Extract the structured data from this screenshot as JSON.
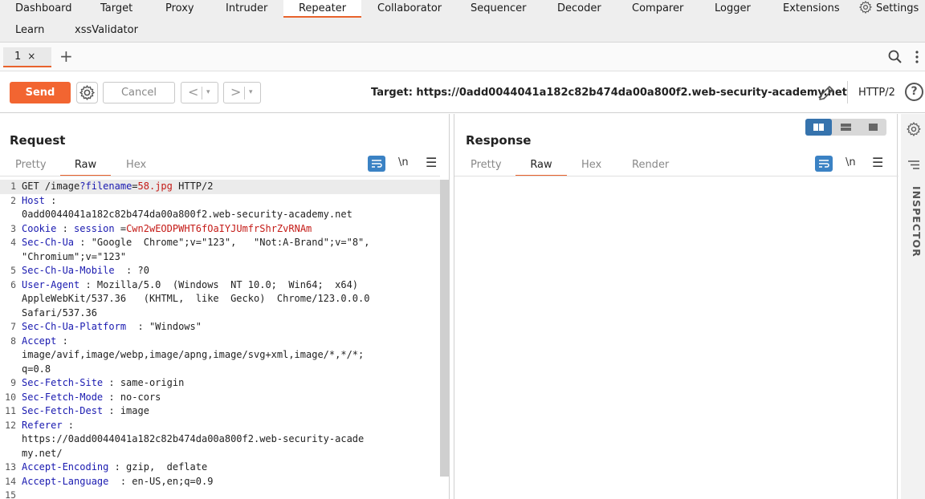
{
  "nav": {
    "items": [
      "Dashboard",
      "Target",
      "Proxy",
      "Intruder",
      "Repeater",
      "Collaborator",
      "Sequencer",
      "Decoder",
      "Comparer",
      "Logger",
      "Extensions"
    ],
    "settings": "Settings",
    "row2": [
      "Learn",
      "xssValidator"
    ],
    "active": "Repeater"
  },
  "tabs": {
    "items": [
      {
        "label": "1",
        "close": "×"
      }
    ],
    "add": "+"
  },
  "toolbar": {
    "send": "Send",
    "cancel": "Cancel",
    "back": "<",
    "forward": ">",
    "dropdown": "▾",
    "target": "Target: https://0add0044041a182c82b474da00a800f2.web-security-academy.net",
    "protocol": "HTTP/2",
    "help": "?"
  },
  "request": {
    "title": "Request",
    "tabs": [
      "Pretty",
      "Raw",
      "Hex"
    ],
    "active_tab": "Raw",
    "newline_toggle": "\\n",
    "lines": [
      {
        "n": "1",
        "parts": [
          [
            "",
            "GET "
          ],
          [
            "",
            "/image"
          ],
          [
            "k",
            "?filename"
          ],
          [
            "",
            "="
          ],
          [
            "v",
            "58.jpg"
          ],
          [
            "",
            " HTTP/2"
          ]
        ]
      },
      {
        "n": "2",
        "parts": [
          [
            "k",
            "Host"
          ],
          [
            "",
            " :"
          ]
        ]
      },
      {
        "n": "",
        "parts": [
          [
            "",
            "0add0044041a182c82b474da00a800f2.web-security-academy.net"
          ]
        ]
      },
      {
        "n": "3",
        "parts": [
          [
            "k",
            "Cookie"
          ],
          [
            "",
            " : "
          ],
          [
            "k",
            "session"
          ],
          [
            "",
            " ="
          ],
          [
            "v",
            "Cwn2wEODPWHT6fOaIYJUmfrShrZvRNAm"
          ]
        ]
      },
      {
        "n": "4",
        "parts": [
          [
            "k",
            "Sec-Ch-Ua"
          ],
          [
            "",
            " : \"Google  Chrome\";v=\"123\",   \"Not:A-Brand\";v=\"8\","
          ]
        ]
      },
      {
        "n": "",
        "parts": [
          [
            "",
            "\"Chromium\";v=\"123\""
          ]
        ]
      },
      {
        "n": "5",
        "parts": [
          [
            "k",
            "Sec-Ch-Ua-Mobile"
          ],
          [
            "",
            "  : ?0"
          ]
        ]
      },
      {
        "n": "6",
        "parts": [
          [
            "k",
            "User-Agent"
          ],
          [
            "",
            " : Mozilla/5.0  (Windows  NT 10.0;  Win64;  x64)"
          ]
        ]
      },
      {
        "n": "",
        "parts": [
          [
            "",
            "AppleWebKit/537.36   (KHTML,  like  Gecko)  Chrome/123.0.0.0"
          ]
        ]
      },
      {
        "n": "",
        "parts": [
          [
            "",
            "Safari/537.36"
          ]
        ]
      },
      {
        "n": "7",
        "parts": [
          [
            "k",
            "Sec-Ch-Ua-Platform"
          ],
          [
            "",
            "  : \"Windows\""
          ]
        ]
      },
      {
        "n": "8",
        "parts": [
          [
            "k",
            "Accept"
          ],
          [
            "",
            " :"
          ]
        ]
      },
      {
        "n": "",
        "parts": [
          [
            "",
            "image/avif,image/webp,image/apng,image/svg+xml,image/*,*/*;"
          ]
        ]
      },
      {
        "n": "",
        "parts": [
          [
            "",
            "q=0.8"
          ]
        ]
      },
      {
        "n": "9",
        "parts": [
          [
            "k",
            "Sec-Fetch-Site"
          ],
          [
            "",
            " : same-origin"
          ]
        ]
      },
      {
        "n": "10",
        "parts": [
          [
            "k",
            "Sec-Fetch-Mode"
          ],
          [
            "",
            " : no-cors"
          ]
        ]
      },
      {
        "n": "11",
        "parts": [
          [
            "k",
            "Sec-Fetch-Dest"
          ],
          [
            "",
            " : image"
          ]
        ]
      },
      {
        "n": "12",
        "parts": [
          [
            "k",
            "Referer"
          ],
          [
            "",
            " :"
          ]
        ]
      },
      {
        "n": "",
        "parts": [
          [
            "",
            "https://0add0044041a182c82b474da00a800f2.web-security-acade"
          ]
        ]
      },
      {
        "n": "",
        "parts": [
          [
            "",
            "my.net/"
          ]
        ]
      },
      {
        "n": "13",
        "parts": [
          [
            "k",
            "Accept-Encoding"
          ],
          [
            "",
            " : gzip,  deflate"
          ]
        ]
      },
      {
        "n": "14",
        "parts": [
          [
            "k",
            "Accept-Language"
          ],
          [
            "",
            "  : en-US,en;q=0.9"
          ]
        ]
      },
      {
        "n": "15",
        "parts": []
      }
    ]
  },
  "response": {
    "title": "Response",
    "tabs": [
      "Pretty",
      "Raw",
      "Hex",
      "Render"
    ],
    "active_tab": "Raw",
    "newline_toggle": "\\n"
  },
  "inspector": {
    "label": "INSPECTOR"
  },
  "colors": {
    "accent": "#e8622c",
    "send": "#f26531",
    "header_key": "#1a1ab0",
    "value": "#c41a16",
    "toggle": "#3b82c4"
  }
}
